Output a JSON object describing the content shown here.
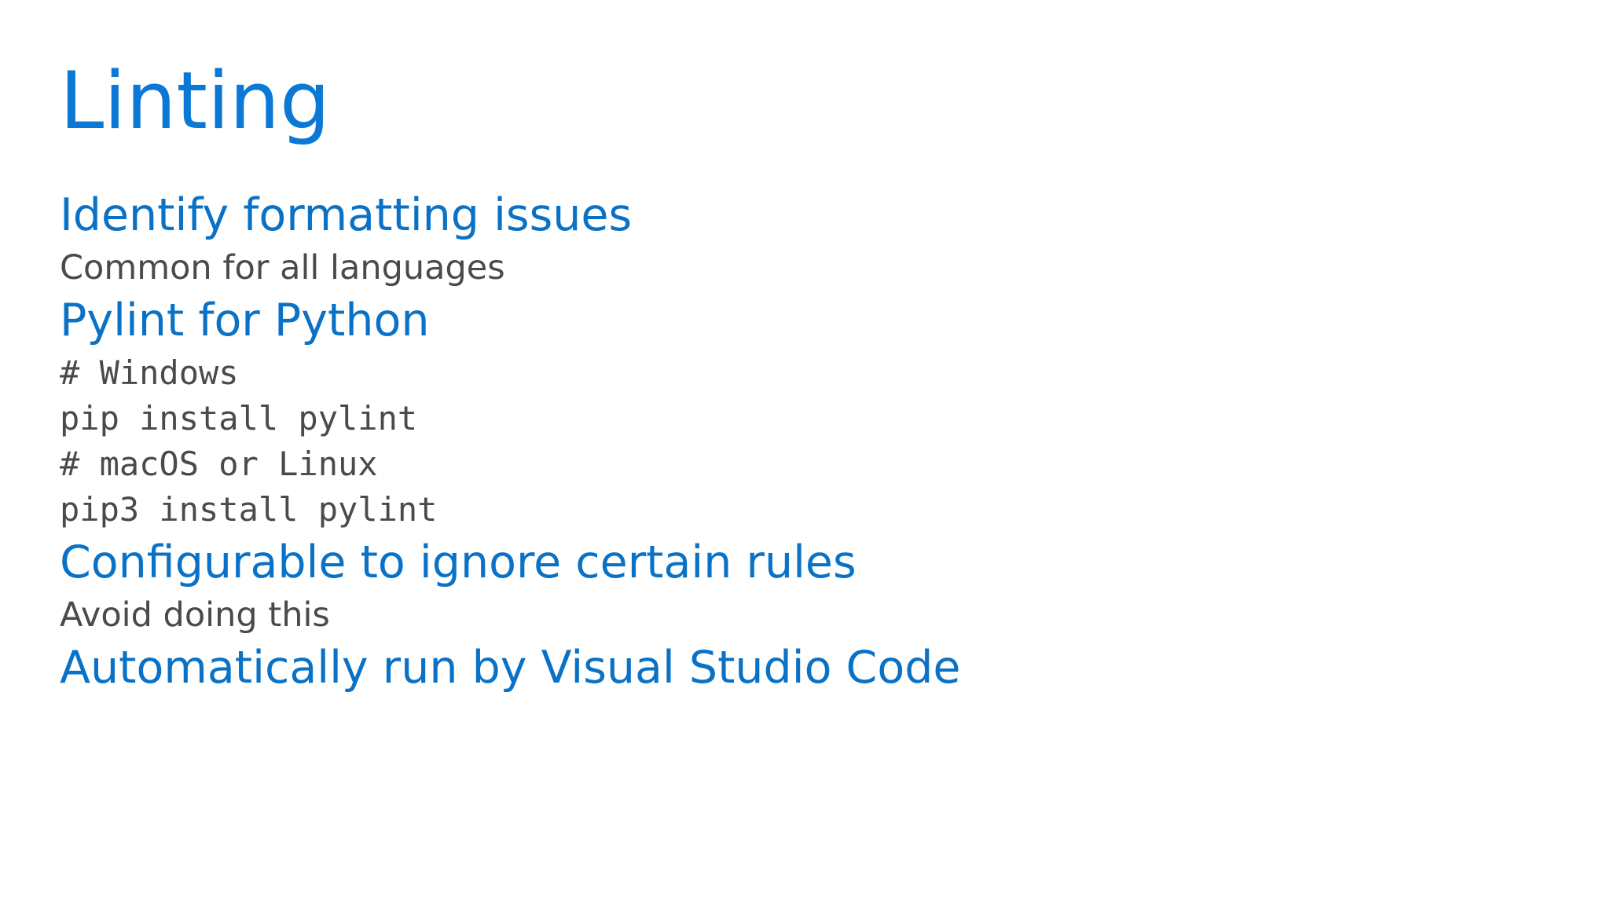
{
  "slide": {
    "title": "Linting",
    "items": [
      {
        "kind": "heading",
        "text": "Identify formatting issues"
      },
      {
        "kind": "sub",
        "text": "Common for all languages"
      },
      {
        "kind": "heading",
        "text": "Pylint for Python"
      },
      {
        "kind": "code",
        "text": "# Windows"
      },
      {
        "kind": "code",
        "text": "pip install pylint"
      },
      {
        "kind": "code",
        "text": "# macOS or Linux"
      },
      {
        "kind": "code",
        "text": "pip3 install pylint"
      },
      {
        "kind": "heading",
        "text": "Configurable to ignore certain rules"
      },
      {
        "kind": "sub",
        "text": "Avoid doing this"
      },
      {
        "kind": "heading",
        "text": "Automatically run by Visual Studio Code"
      }
    ]
  },
  "colors": {
    "title": "#0a78d4",
    "heading": "#0a72c6",
    "body_text": "#4a4a4a",
    "background": "#ffffff"
  }
}
